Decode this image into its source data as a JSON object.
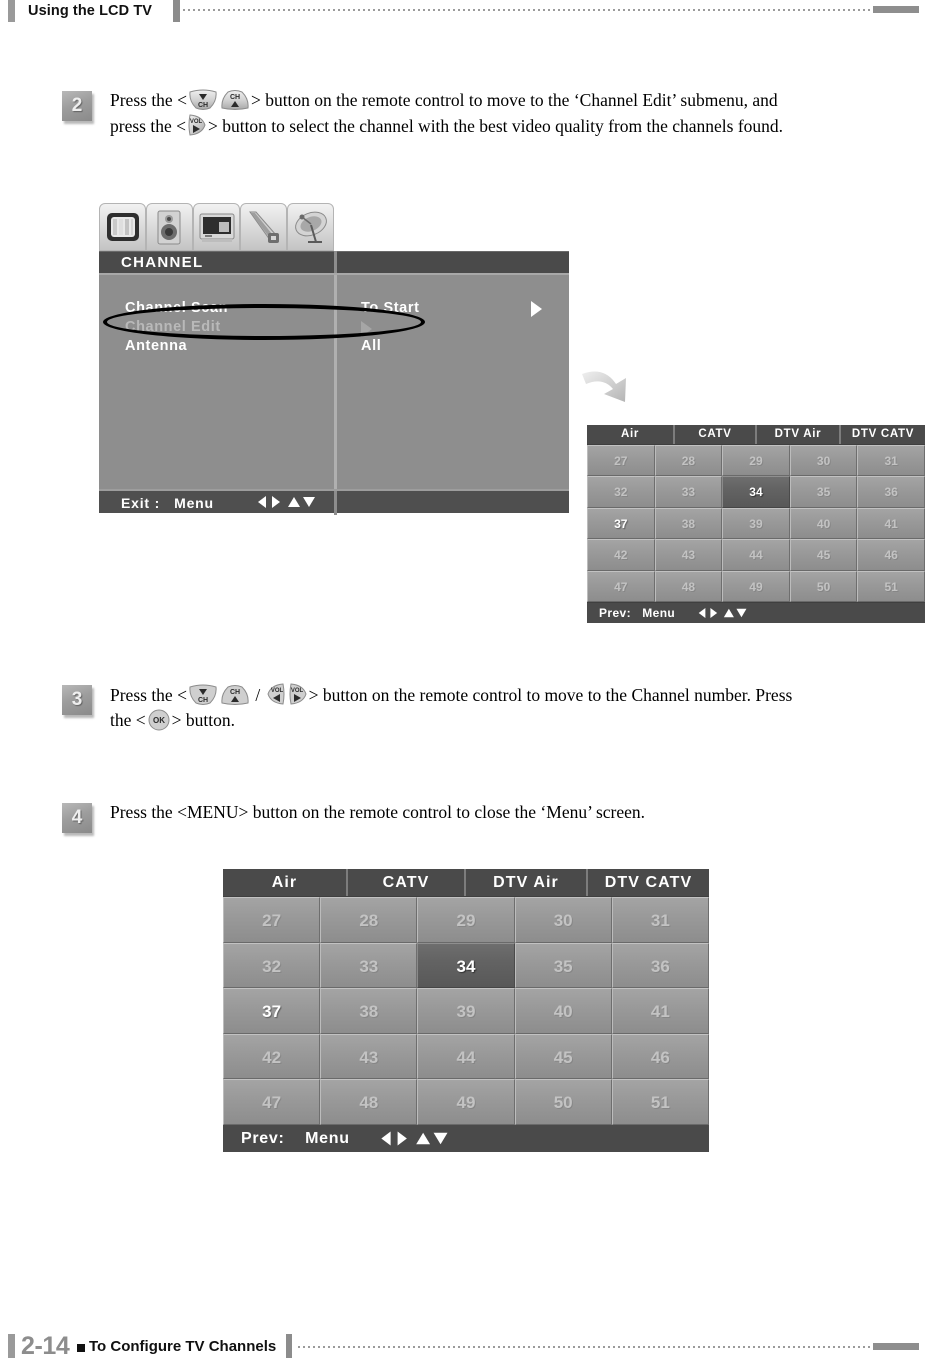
{
  "header": {
    "title": "Using the LCD TV"
  },
  "steps": [
    {
      "number": "2",
      "text_part1": "Press the <",
      "icons1": [
        "ch-down-button-icon",
        "ch-up-button-icon"
      ],
      "text_part2": "> button on the remote control to move to the ‘Channel Edit’ submenu, and press the <",
      "icons2": [
        "vol-right-button-icon"
      ],
      "text_part3": "> button to select the channel with the best video quality from the channels found."
    },
    {
      "number": "3",
      "text_part1": "Press the <",
      "icons1": [
        "ch-down-button-icon",
        "ch-up-button-icon",
        "slash",
        "vol-left-button-icon",
        "vol-right-button-icon"
      ],
      "text_part2": "> button on the remote control to move to the Channel number. Press the <",
      "icons2": [
        "ok-button-icon"
      ],
      "text_part3": "> button."
    },
    {
      "number": "4",
      "text_part1": "Press the <MENU> button on the remote control to close the ‘Menu’ screen."
    }
  ],
  "osd_menu": {
    "title": "CHANNEL",
    "tabs": [
      "picture-tv-icon",
      "sound-speaker-icon",
      "setup-screen-icon",
      "tools-icon",
      "antenna-satellite-icon"
    ],
    "rows": [
      {
        "label": "Channel Scan",
        "value": "To Start",
        "state": "normal",
        "has_arrow": true
      },
      {
        "label": "Channel Edit",
        "value": "",
        "state": "dim",
        "has_arrow": false
      },
      {
        "label": "Antenna",
        "value": "All",
        "state": "normal",
        "has_arrow": false
      }
    ],
    "footer": {
      "exit_label": "Exit :",
      "menu_label": "Menu",
      "arrows": "◀▶▲▼"
    }
  },
  "channel_grid": {
    "columns": [
      "Air",
      "CATV",
      "DTV Air",
      "DTV CATV"
    ],
    "rows": [
      [
        "27",
        "28",
        "29",
        "30",
        "31"
      ],
      [
        "32",
        "33",
        "34",
        "35",
        "36"
      ],
      [
        "37",
        "38",
        "39",
        "40",
        "41"
      ],
      [
        "42",
        "43",
        "44",
        "45",
        "46"
      ],
      [
        "47",
        "48",
        "49",
        "50",
        "51"
      ]
    ],
    "selected": "34",
    "highlighted": "37",
    "footer": {
      "prev_label": "Prev:",
      "menu_label": "Menu",
      "arrows": "◀▶▲▼"
    }
  },
  "footer": {
    "page_number": "2-14",
    "section": "To Configure TV Channels"
  },
  "colors": {
    "osd_background": "#8e8e8e",
    "osd_titlebar": "#4a4a4a",
    "grid_cell": "#9a9a9a",
    "grid_cell_selected": "#636363",
    "accent_gray": "#8e8e8e",
    "text_black": "#111111"
  }
}
